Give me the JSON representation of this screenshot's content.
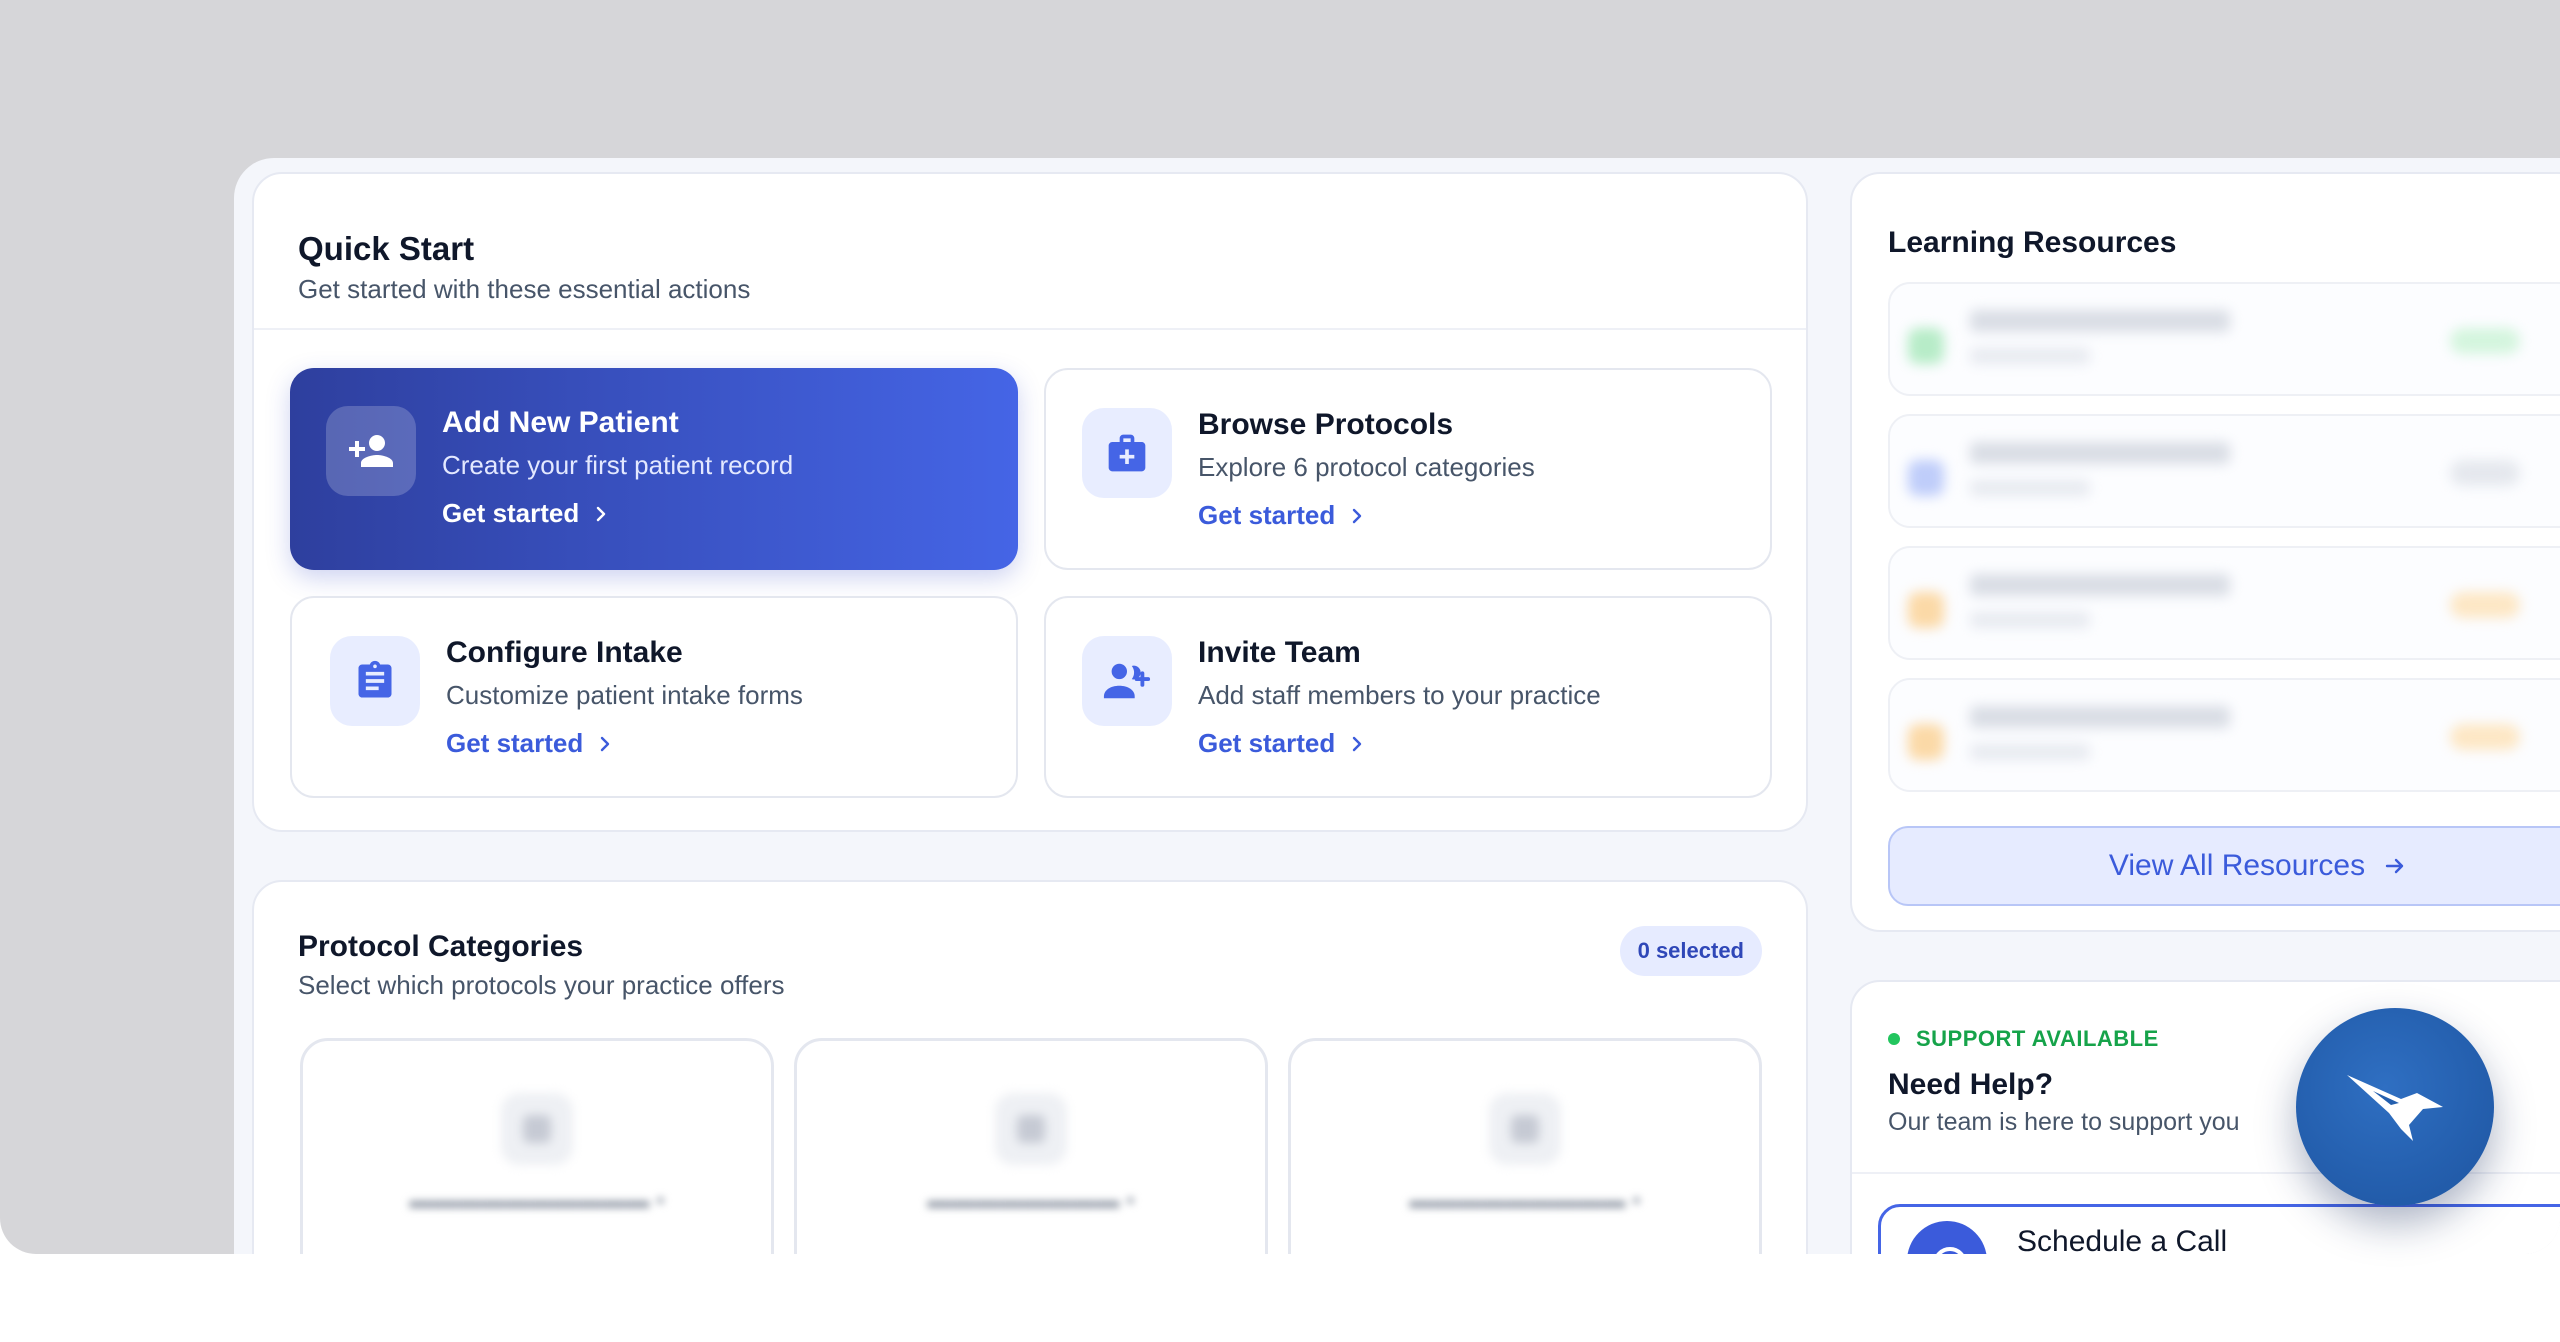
{
  "quick_start": {
    "title": "Quick Start",
    "subtitle": "Get started with these essential actions",
    "actions": [
      {
        "title": "Add New Patient",
        "description": "Create your first patient record",
        "link": "Get started"
      },
      {
        "title": "Browse Protocols",
        "description": "Explore 6 protocol categories",
        "link": "Get started"
      },
      {
        "title": "Configure Intake",
        "description": "Customize patient intake forms",
        "link": "Get started"
      },
      {
        "title": "Invite Team",
        "description": "Add staff members to your practice",
        "link": "Get started"
      }
    ]
  },
  "protocol_categories": {
    "title": "Protocol Categories",
    "subtitle": "Select which protocols your practice offers",
    "selected_badge": "0 selected"
  },
  "learning_resources": {
    "title": "Learning Resources",
    "view_all": "View All Resources"
  },
  "help": {
    "status": "SUPPORT AVAILABLE",
    "title": "Need Help?",
    "subtitle": "Our team is here to support you",
    "schedule_call": "Schedule a Call"
  },
  "colors": {
    "accent": "#3b5bdb",
    "primary_gradient_start": "#2e3f9e",
    "primary_gradient_end": "#4565e6",
    "success": "#16a34a",
    "fab": "#245fae"
  }
}
